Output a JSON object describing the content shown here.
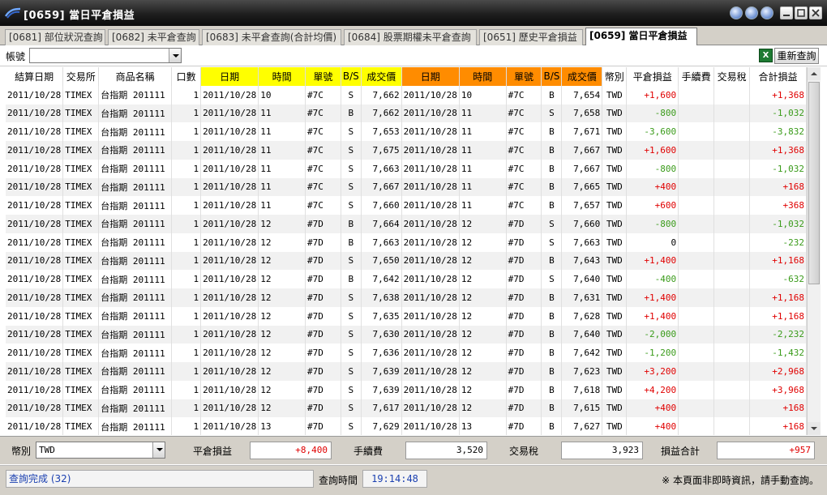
{
  "window": {
    "title": "[0659] 當日平倉損益"
  },
  "tabs": [
    {
      "label": "[0681] 部位狀況查詢",
      "active": false
    },
    {
      "label": "[0682] 未平倉查詢",
      "active": false
    },
    {
      "label": "[0683] 未平倉查詢(合計均價)",
      "active": false
    },
    {
      "label": "[0684] 股票期權未平倉查詢",
      "active": false
    },
    {
      "label": "[0651] 歷史平倉損益",
      "active": false
    },
    {
      "label": "[0659] 當日平倉損益",
      "active": true
    }
  ],
  "toolbar": {
    "account_label": "帳號",
    "account_value": "",
    "refresh_label": "重新查詢",
    "excel_icon": "excel-export-icon"
  },
  "colors": {
    "open_header": "#ffff00",
    "close_header": "#ff8c00",
    "profit": "#e00000",
    "loss": "#3a9b1a"
  },
  "table": {
    "headers": [
      "結算日期",
      "交易所",
      "商品名稱",
      "口數",
      "日期",
      "時間",
      "單號",
      "B/S",
      "成交價",
      "日期",
      "時間",
      "單號",
      "B/S",
      "成交價",
      "幣別",
      "平倉損益",
      "手續費",
      "交易稅",
      "合計損益"
    ],
    "rows": [
      [
        "2011/10/28",
        "TIMEX",
        "台指期 201111",
        "1",
        "2011/10/28",
        "10",
        "#7C",
        "S",
        "7,662",
        "2011/10/28",
        "10",
        "#7C",
        "B",
        "7,654",
        "TWD",
        "+1,600",
        "",
        "",
        "+1,368"
      ],
      [
        "2011/10/28",
        "TIMEX",
        "台指期 201111",
        "1",
        "2011/10/28",
        "11",
        "#7C",
        "B",
        "7,662",
        "2011/10/28",
        "11",
        "#7C",
        "S",
        "7,658",
        "TWD",
        "-800",
        "",
        "",
        "-1,032"
      ],
      [
        "2011/10/28",
        "TIMEX",
        "台指期 201111",
        "1",
        "2011/10/28",
        "11",
        "#7C",
        "S",
        "7,653",
        "2011/10/28",
        "11",
        "#7C",
        "B",
        "7,671",
        "TWD",
        "-3,600",
        "",
        "",
        "-3,832"
      ],
      [
        "2011/10/28",
        "TIMEX",
        "台指期 201111",
        "1",
        "2011/10/28",
        "11",
        "#7C",
        "S",
        "7,675",
        "2011/10/28",
        "11",
        "#7C",
        "B",
        "7,667",
        "TWD",
        "+1,600",
        "",
        "",
        "+1,368"
      ],
      [
        "2011/10/28",
        "TIMEX",
        "台指期 201111",
        "1",
        "2011/10/28",
        "11",
        "#7C",
        "S",
        "7,663",
        "2011/10/28",
        "11",
        "#7C",
        "B",
        "7,667",
        "TWD",
        "-800",
        "",
        "",
        "-1,032"
      ],
      [
        "2011/10/28",
        "TIMEX",
        "台指期 201111",
        "1",
        "2011/10/28",
        "11",
        "#7C",
        "S",
        "7,667",
        "2011/10/28",
        "11",
        "#7C",
        "B",
        "7,665",
        "TWD",
        "+400",
        "",
        "",
        "+168"
      ],
      [
        "2011/10/28",
        "TIMEX",
        "台指期 201111",
        "1",
        "2011/10/28",
        "11",
        "#7C",
        "S",
        "7,660",
        "2011/10/28",
        "11",
        "#7C",
        "B",
        "7,657",
        "TWD",
        "+600",
        "",
        "",
        "+368"
      ],
      [
        "2011/10/28",
        "TIMEX",
        "台指期 201111",
        "1",
        "2011/10/28",
        "12",
        "#7D",
        "B",
        "7,664",
        "2011/10/28",
        "12",
        "#7D",
        "S",
        "7,660",
        "TWD",
        "-800",
        "",
        "",
        "-1,032"
      ],
      [
        "2011/10/28",
        "TIMEX",
        "台指期 201111",
        "1",
        "2011/10/28",
        "12",
        "#7D",
        "B",
        "7,663",
        "2011/10/28",
        "12",
        "#7D",
        "S",
        "7,663",
        "TWD",
        "0",
        "",
        "",
        "-232"
      ],
      [
        "2011/10/28",
        "TIMEX",
        "台指期 201111",
        "1",
        "2011/10/28",
        "12",
        "#7D",
        "S",
        "7,650",
        "2011/10/28",
        "12",
        "#7D",
        "B",
        "7,643",
        "TWD",
        "+1,400",
        "",
        "",
        "+1,168"
      ],
      [
        "2011/10/28",
        "TIMEX",
        "台指期 201111",
        "1",
        "2011/10/28",
        "12",
        "#7D",
        "B",
        "7,642",
        "2011/10/28",
        "12",
        "#7D",
        "S",
        "7,640",
        "TWD",
        "-400",
        "",
        "",
        "-632"
      ],
      [
        "2011/10/28",
        "TIMEX",
        "台指期 201111",
        "1",
        "2011/10/28",
        "12",
        "#7D",
        "S",
        "7,638",
        "2011/10/28",
        "12",
        "#7D",
        "B",
        "7,631",
        "TWD",
        "+1,400",
        "",
        "",
        "+1,168"
      ],
      [
        "2011/10/28",
        "TIMEX",
        "台指期 201111",
        "1",
        "2011/10/28",
        "12",
        "#7D",
        "S",
        "7,635",
        "2011/10/28",
        "12",
        "#7D",
        "B",
        "7,628",
        "TWD",
        "+1,400",
        "",
        "",
        "+1,168"
      ],
      [
        "2011/10/28",
        "TIMEX",
        "台指期 201111",
        "1",
        "2011/10/28",
        "12",
        "#7D",
        "S",
        "7,630",
        "2011/10/28",
        "12",
        "#7D",
        "B",
        "7,640",
        "TWD",
        "-2,000",
        "",
        "",
        "-2,232"
      ],
      [
        "2011/10/28",
        "TIMEX",
        "台指期 201111",
        "1",
        "2011/10/28",
        "12",
        "#7D",
        "S",
        "7,636",
        "2011/10/28",
        "12",
        "#7D",
        "B",
        "7,642",
        "TWD",
        "-1,200",
        "",
        "",
        "-1,432"
      ],
      [
        "2011/10/28",
        "TIMEX",
        "台指期 201111",
        "1",
        "2011/10/28",
        "12",
        "#7D",
        "S",
        "7,639",
        "2011/10/28",
        "12",
        "#7D",
        "B",
        "7,623",
        "TWD",
        "+3,200",
        "",
        "",
        "+2,968"
      ],
      [
        "2011/10/28",
        "TIMEX",
        "台指期 201111",
        "1",
        "2011/10/28",
        "12",
        "#7D",
        "S",
        "7,639",
        "2011/10/28",
        "12",
        "#7D",
        "B",
        "7,618",
        "TWD",
        "+4,200",
        "",
        "",
        "+3,968"
      ],
      [
        "2011/10/28",
        "TIMEX",
        "台指期 201111",
        "1",
        "2011/10/28",
        "12",
        "#7D",
        "S",
        "7,617",
        "2011/10/28",
        "12",
        "#7D",
        "B",
        "7,615",
        "TWD",
        "+400",
        "",
        "",
        "+168"
      ],
      [
        "2011/10/28",
        "TIMEX",
        "台指期 201111",
        "1",
        "2011/10/28",
        "13",
        "#7D",
        "S",
        "7,629",
        "2011/10/28",
        "13",
        "#7D",
        "B",
        "7,627",
        "TWD",
        "+400",
        "",
        "",
        "+168"
      ]
    ]
  },
  "summary": {
    "currency_label": "幣別",
    "currency_value": "TWD",
    "pnl_label": "平倉損益",
    "pnl_value": "+8,400",
    "fee_label": "手續費",
    "fee_value": "3,520",
    "tax_label": "交易稅",
    "tax_value": "3,923",
    "total_label": "損益合計",
    "total_value": "+957"
  },
  "status": {
    "message": "查詢完成 (32)",
    "query_time_label": "查詢時間",
    "query_time": "19:14:48",
    "notice": "※ 本頁面非即時資訊，請手動查詢。"
  }
}
